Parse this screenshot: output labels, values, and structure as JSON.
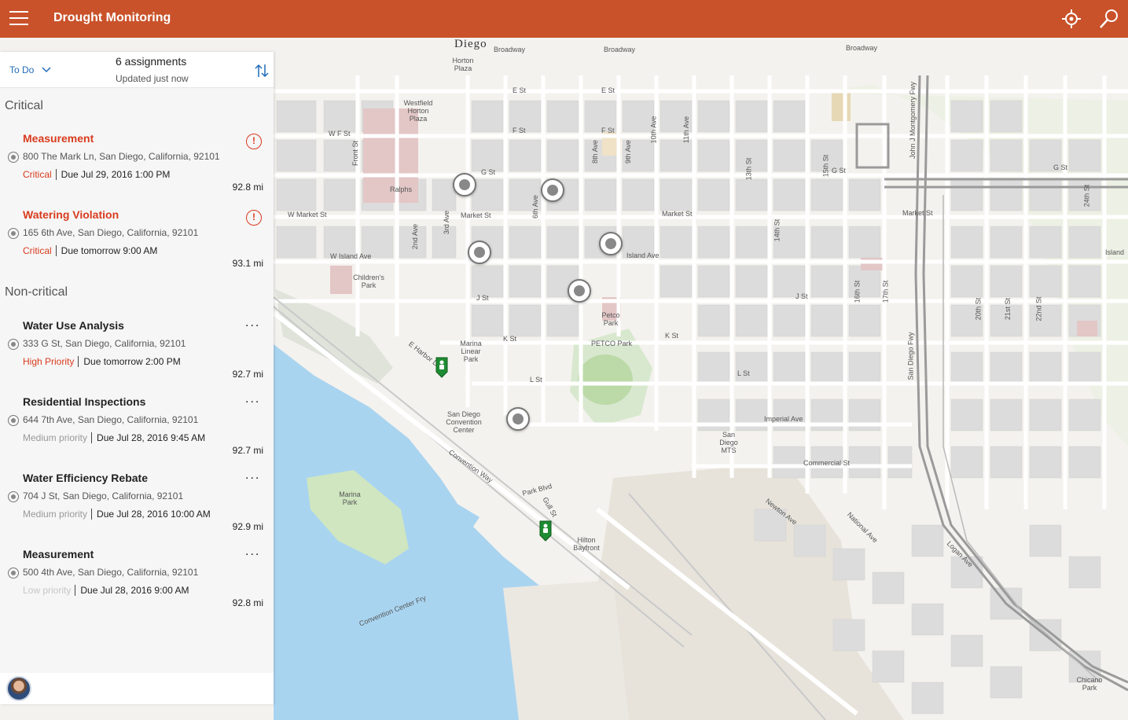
{
  "header": {
    "title": "Drought Monitoring",
    "menu_icon": "hamburger-icon",
    "locate_icon": "locate-icon",
    "search_icon": "search-icon",
    "color": "#c9522a"
  },
  "panel": {
    "filter_label": "To Do",
    "assignment_count": "6 assignments",
    "updated": "Updated just now",
    "sections": [
      {
        "title": "Critical",
        "items": [
          {
            "title": "Measurement",
            "address": "800 The Mark Ln, San Diego, California, 92101",
            "priority": "Critical",
            "due": "Due Jul 29, 2016 1:00 PM",
            "distance": "92.8 mi"
          },
          {
            "title": "Watering Violation",
            "address": "165 6th Ave, San Diego, California, 92101",
            "priority": "Critical",
            "due": "Due tomorrow 9:00 AM",
            "distance": "93.1 mi"
          }
        ]
      },
      {
        "title": "Non-critical",
        "items": [
          {
            "title": "Water Use Analysis",
            "address": "333 G St, San Diego, California, 92101",
            "priority": "High Priority",
            "due": "Due tomorrow 2:00 PM",
            "distance": "92.7 mi"
          },
          {
            "title": "Residential Inspections",
            "address": "644 7th Ave, San Diego, California, 92101",
            "priority": "Medium priority",
            "due": "Due Jul 28, 2016 9:45 AM",
            "distance": "92.7 mi"
          },
          {
            "title": "Water Efficiency Rebate",
            "address": "704 J St, San Diego, California, 92101",
            "priority": "Medium priority",
            "due": "Due Jul 28, 2016 10:00 AM",
            "distance": "92.9 mi"
          },
          {
            "title": "Measurement",
            "address": "500 4th Ave, San Diego, California, 92101",
            "priority": "Low priority",
            "due": "Due Jul 28, 2016 9:00 AM",
            "distance": "92.8 mi"
          }
        ]
      }
    ]
  },
  "map": {
    "labels": {
      "diego": "Diego",
      "broadway": "Broadway",
      "broadway2": "Broadway",
      "broadway3": "Broadway",
      "e_st": "E St",
      "e_st2": "E St",
      "f_st": "F St",
      "f_st2": "F St",
      "w_f_st": "W F St",
      "g_st": "G St",
      "g_st2": "G St",
      "g_st3": "G St",
      "w_market_st": "W Market St",
      "market_st": "Market St",
      "market_st2": "Market St",
      "market_st3": "Market St",
      "w_island_ave": "W Island Ave",
      "island_ave": "Island Ave",
      "j_st": "J St",
      "j_st2": "J St",
      "k_st": "K St",
      "k_st2": "K St",
      "l_st": "L St",
      "l_st2": "L St",
      "imperial_ave": "Imperial Ave",
      "commercial_st": "Commercial St",
      "petco_park": "PETCO Park",
      "petco_park2": "Petco Park",
      "convention_center": "San Diego Convention Center",
      "convention_way": "Convention Way",
      "harbor_dr": "E Harbor Dr",
      "marina_park": "Marina Park",
      "park_blvd": "Park Blvd",
      "hilton": "Hilton Bayfront",
      "sd_fwy": "San Diego Fwy",
      "jm_fwy": "John J Montgomery Fwy",
      "horton_plaza": "Horton Plaza",
      "westfield": "Westfield Horton Plaza",
      "ralphs": "Ralphs",
      "childrens_park": "Children's Park",
      "chicano_park": "Chicano Park",
      "newton_ave": "Newton Ave",
      "national_ave": "National Ave",
      "logan_ave": "Logan Ave",
      "island": "Island",
      "front_st": "Front St",
      "second_ave": "2nd Ave",
      "third_ave": "3rd Ave",
      "sixth_ave": "6th Ave",
      "eighth_ave": "8th Ave",
      "ninth_ave": "9th Ave",
      "tenth_ave": "10th Ave",
      "eleventh_ave": "11th Ave",
      "thirteenth_st": "13th St",
      "fourteenth_st": "14th St",
      "fifteenth_st": "15th St",
      "sixteenth_st": "16th St",
      "seventeenth_st": "17th St",
      "twentieth_st": "20th St",
      "twentyfirst_st": "21st St",
      "twentysecond_st": "22nd St",
      "twentyfourth_st": "24th St",
      "gull_st": "Gull St",
      "marina_linear_park": "Marina Linear Park",
      "sd_mts": "San Diego MTS",
      "convention_center_fry": "Convention Center Fry"
    }
  },
  "user": {
    "avatar_icon": "user-avatar-icon"
  }
}
